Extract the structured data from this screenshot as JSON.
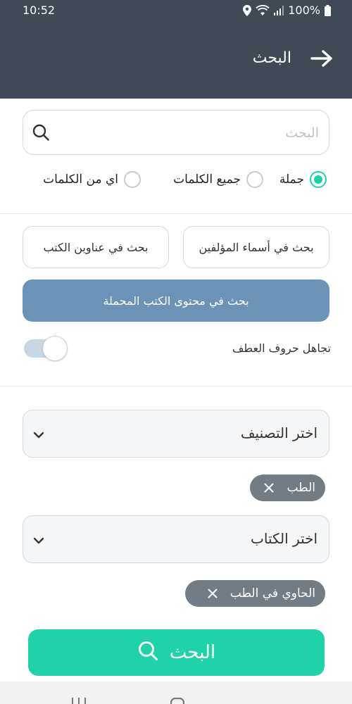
{
  "status_bar": {
    "time": "10:52",
    "battery": "100%"
  },
  "header": {
    "title": "البحث"
  },
  "search": {
    "placeholder": "البحث",
    "value": ""
  },
  "match_mode": {
    "options": [
      "جملة",
      "جميع الكلمات",
      "اي من الكلمات"
    ],
    "selected": "جملة"
  },
  "search_in": {
    "authors_label": "بحث في أسماء المؤلفين",
    "titles_label": "بحث في عناوين الكتب",
    "content_label": "بحث في محتوى الكتب المحملة"
  },
  "ignore_conjunctions": {
    "label": "تجاهل حروف العطف",
    "enabled": false
  },
  "category": {
    "placeholder": "اختر التصنيف",
    "chip": "الطب"
  },
  "book": {
    "placeholder": "اختر الكتاب",
    "chip": "الحاوي في الطب"
  },
  "submit": {
    "label": "البحث"
  },
  "colors": {
    "header_bg": "#3f4a54",
    "accent": "#20d2a7",
    "content_button": "#6b93b8",
    "chip_bg": "#717c85"
  }
}
